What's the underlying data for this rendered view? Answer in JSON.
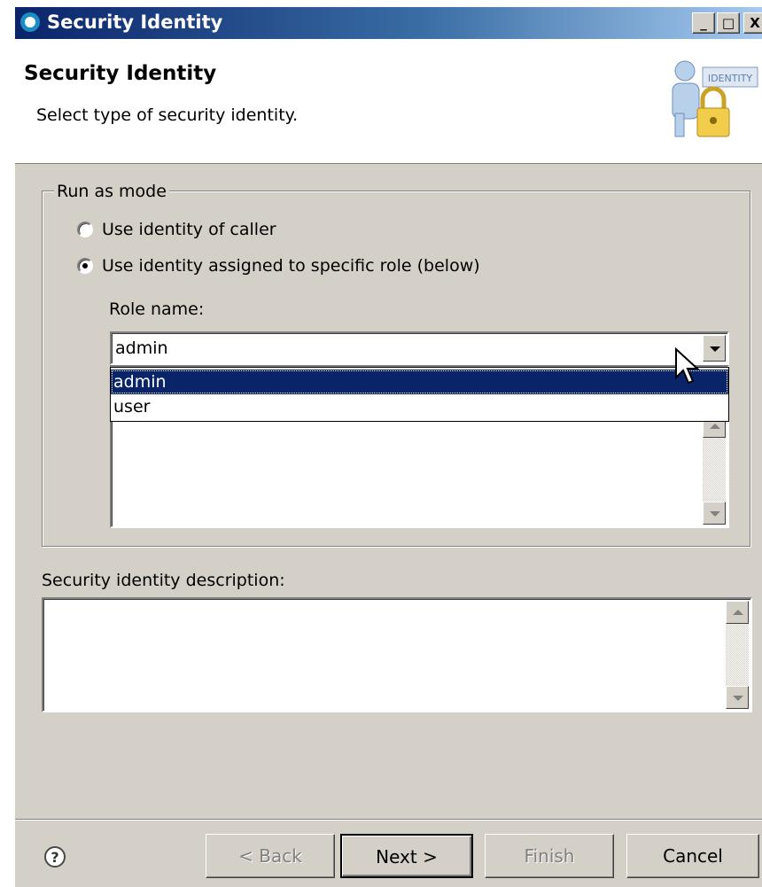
{
  "window": {
    "title": "Security Identity",
    "min_label": "_",
    "max_label": "□",
    "close_label": "X"
  },
  "header": {
    "title": "Security Identity",
    "subtitle": "Select type of security identity.",
    "logo_text": "IDENTITY"
  },
  "run_as": {
    "legend": "Run as mode",
    "options": [
      {
        "label": "Use identity of caller",
        "selected": false
      },
      {
        "label": "Use identity assigned to specific role (below)",
        "selected": true
      }
    ]
  },
  "role": {
    "label": "Role name:",
    "value": "admin",
    "dropdown_items": [
      "admin",
      "user"
    ],
    "highlighted": "admin"
  },
  "description": {
    "label": "Security identity description:",
    "value": ""
  },
  "buttons": {
    "back": "< Back",
    "next": "Next >",
    "finish": "Finish",
    "cancel": "Cancel",
    "help": "?"
  }
}
